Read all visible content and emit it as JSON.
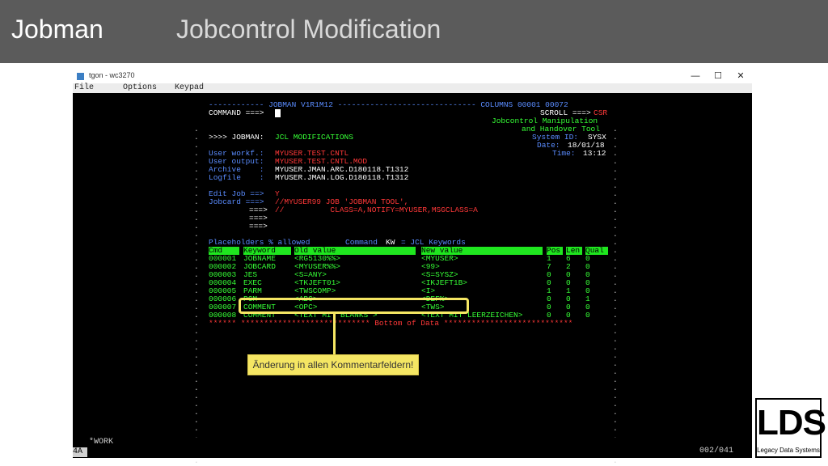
{
  "slide": {
    "title": "Jobman",
    "subtitle": "Jobcontrol Modification"
  },
  "window": {
    "title": "tgon - wc3270",
    "minimize_icon": "minimize-icon",
    "maximize_icon": "maximize-icon",
    "close_icon": "close-icon"
  },
  "menu": [
    "File",
    "Options",
    "Keypad"
  ],
  "terminal": {
    "header_line": "------------ JOBMAN V1R1M12 ------------------------------ COLUMNS 00001 00072",
    "command_label": "COMMAND ===>",
    "scroll_label": "SCROLL ===>",
    "scroll_value": "CSR",
    "tool_line1": "Jobcontrol Manipulation",
    "tool_line2": "and Handover Tool",
    "system_label": "System ID:",
    "system_value": "SYSX",
    "date_label": "Date:",
    "date_value": "18/01/18",
    "time_label": "Time:",
    "time_value": "13:12",
    "section_prompt": ">>>> JOBMAN:",
    "section_title": "JCL MODIFICATIONS",
    "user_workf_label": "User workf.:",
    "user_workf_value": "MYUSER.TEST.CNTL",
    "user_output_label": "User output:",
    "user_output_value": "MYUSER.TEST.CNTL.MOD",
    "archive_label": "Archive    :",
    "archive_value": "MYUSER.JMAN.ARC.D180118.T1312",
    "logfile_label": "Logfile    :",
    "logfile_value": "MYUSER.JMAN.LOG.D180118.T1312",
    "edit_job_label": "Edit Job ==>",
    "edit_job_value": "Y",
    "jobcard_label": "Jobcard ===>",
    "jobcard_line1": "//MYUSER99 JOB 'JOBMAN TOOL',",
    "jobcard_line2": "//          CLASS=A,NOTIFY=MYUSER,MSGCLASS=A",
    "arrow": "===>",
    "placeholders_text": "Placeholders % allowed",
    "command_kw_label": "Command",
    "command_kw_value": "KW",
    "command_kw_rest": "= JCL Keywords",
    "table_headers": [
      "Cmd",
      "Keyword",
      "Old value",
      "New value",
      "Pos",
      "Len",
      "Qual"
    ],
    "rows": [
      {
        "num": "000001",
        "keyword": "JOBNAME",
        "old": "<RG5130%%>",
        "new": "<MYUSER>",
        "pos": "1",
        "len": "6",
        "qual": "0"
      },
      {
        "num": "000002",
        "keyword": "JOBCARD",
        "old": "<MYUSER%%>",
        "new": "<99>",
        "pos": "7",
        "len": "2",
        "qual": "0"
      },
      {
        "num": "000003",
        "keyword": "JES",
        "old": "<S=ANY>",
        "new": "<S=SYSZ>",
        "pos": "0",
        "len": "0",
        "qual": "0"
      },
      {
        "num": "000004",
        "keyword": "EXEC",
        "old": "<TKJEFT01>",
        "new": "<IKJEFT1B>",
        "pos": "0",
        "len": "0",
        "qual": "0"
      },
      {
        "num": "000005",
        "keyword": "PARM",
        "old": "<TWSCOMP>",
        "new": "<I>",
        "pos": "1",
        "len": "1",
        "qual": "0"
      },
      {
        "num": "000006",
        "keyword": "PGM",
        "old": "<ABC>",
        "new": "<DEF%>",
        "pos": "0",
        "len": "0",
        "qual": "1"
      },
      {
        "num": "000007",
        "keyword": "COMMENT",
        "old": "<OPC>",
        "new": "<TWS>",
        "pos": "0",
        "len": "0",
        "qual": "0"
      },
      {
        "num": "000008",
        "keyword": "COMMENT",
        "old": "<TEXT MIT BLANKS >",
        "new": "<TEXT MIT LEERZEICHEN>",
        "pos": "0",
        "len": "0",
        "qual": "0"
      }
    ],
    "bottom_line": "****** **************************** Bottom of Data ****************************"
  },
  "status": {
    "indicator": "4A",
    "mode": "*WORK",
    "cursor_pos": "002/041"
  },
  "callout": {
    "text": "Änderung in allen Kommentarfeldern!"
  },
  "logo": {
    "text": "LDS",
    "subtext": "Legacy Data Systems"
  },
  "colors": {
    "header_bg": "#5b5b5b",
    "terminal_green": "#36ff36",
    "terminal_red": "#ff3838",
    "terminal_blue": "#5a8cff",
    "highlight": "#f5e663"
  }
}
